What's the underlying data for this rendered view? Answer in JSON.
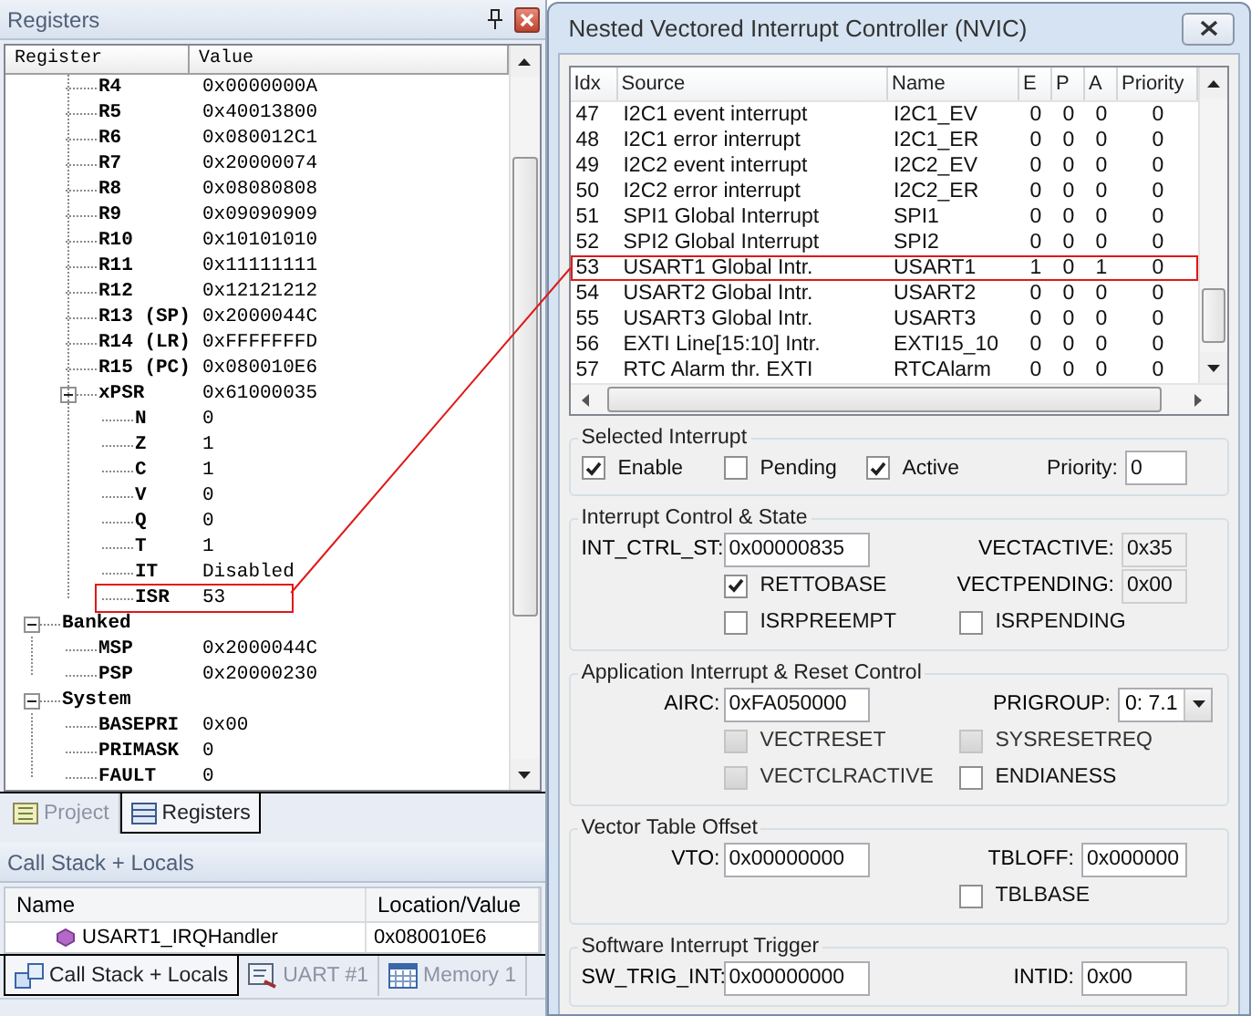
{
  "registers": {
    "title": "Registers",
    "columns": [
      "Register",
      "Value"
    ],
    "tree": [
      {
        "children": [
          {
            "name": "R4",
            "value": "0x0000000A"
          },
          {
            "name": "R5",
            "value": "0x40013800"
          },
          {
            "name": "R6",
            "value": "0x080012C1"
          },
          {
            "name": "R7",
            "value": "0x20000074"
          },
          {
            "name": "R8",
            "value": "0x08080808"
          },
          {
            "name": "R9",
            "value": "0x09090909"
          },
          {
            "name": "R10",
            "value": "0x10101010"
          },
          {
            "name": "R11",
            "value": "0x11111111"
          },
          {
            "name": "R12",
            "value": "0x12121212"
          },
          {
            "name": "R13 (SP)",
            "value": "0x2000044C"
          },
          {
            "name": "R14 (LR)",
            "value": "0xFFFFFFFD"
          },
          {
            "name": "R15 (PC)",
            "value": "0x080010E6"
          },
          {
            "name": "xPSR",
            "value": "0x61000035",
            "expanded": true,
            "children": [
              {
                "name": "N",
                "value": "0"
              },
              {
                "name": "Z",
                "value": "1"
              },
              {
                "name": "C",
                "value": "1"
              },
              {
                "name": "V",
                "value": "0"
              },
              {
                "name": "Q",
                "value": "0"
              },
              {
                "name": "T",
                "value": "1"
              },
              {
                "name": "IT",
                "value": "Disabled"
              },
              {
                "name": "ISR",
                "value": "53",
                "highlighted": true
              }
            ]
          }
        ]
      },
      {
        "name": "Banked",
        "expanded": true,
        "children": [
          {
            "name": "MSP",
            "value": "0x2000044C"
          },
          {
            "name": "PSP",
            "value": "0x20000230"
          }
        ]
      },
      {
        "name": "System",
        "expanded": true,
        "children": [
          {
            "name": "BASEPRI",
            "value": "0x00"
          },
          {
            "name": "PRIMASK",
            "value": "0"
          },
          {
            "name": "FAULT",
            "value": "0"
          }
        ]
      }
    ]
  },
  "left_tabs": [
    {
      "label": "Project",
      "selected": false
    },
    {
      "label": "Registers",
      "selected": true
    }
  ],
  "call_stack": {
    "title": "Call Stack + Locals",
    "columns": [
      "Name",
      "Location/Value"
    ],
    "rows": [
      {
        "name": "USART1_IRQHandler",
        "value": "0x080010E6"
      }
    ]
  },
  "bottom_tabs": [
    {
      "label": "Call Stack + Locals",
      "selected": true
    },
    {
      "label": "UART #1",
      "selected": false
    },
    {
      "label": "Memory 1",
      "selected": false
    }
  ],
  "nvic": {
    "title": "Nested Vectored Interrupt Controller (NVIC)",
    "columns": [
      "Idx",
      "Source",
      "Name",
      "E",
      "P",
      "A",
      "Priority"
    ],
    "rows": [
      {
        "idx": "47",
        "source": "I2C1 event interrupt",
        "name": "I2C1_EV",
        "e": "0",
        "p": "0",
        "a": "0",
        "priority": "0",
        "highlighted": false
      },
      {
        "idx": "48",
        "source": "I2C1 error interrupt",
        "name": "I2C1_ER",
        "e": "0",
        "p": "0",
        "a": "0",
        "priority": "0",
        "highlighted": false
      },
      {
        "idx": "49",
        "source": "I2C2 event interrupt",
        "name": "I2C2_EV",
        "e": "0",
        "p": "0",
        "a": "0",
        "priority": "0",
        "highlighted": false
      },
      {
        "idx": "50",
        "source": "I2C2 error interrupt",
        "name": "I2C2_ER",
        "e": "0",
        "p": "0",
        "a": "0",
        "priority": "0",
        "highlighted": false
      },
      {
        "idx": "51",
        "source": "SPI1 Global Interrupt",
        "name": "SPI1",
        "e": "0",
        "p": "0",
        "a": "0",
        "priority": "0",
        "highlighted": false
      },
      {
        "idx": "52",
        "source": "SPI2 Global Interrupt",
        "name": "SPI2",
        "e": "0",
        "p": "0",
        "a": "0",
        "priority": "0",
        "highlighted": false
      },
      {
        "idx": "53",
        "source": "USART1 Global Intr.",
        "name": "USART1",
        "e": "1",
        "p": "0",
        "a": "1",
        "priority": "0",
        "highlighted": true
      },
      {
        "idx": "54",
        "source": "USART2 Global Intr.",
        "name": "USART2",
        "e": "0",
        "p": "0",
        "a": "0",
        "priority": "0",
        "highlighted": false
      },
      {
        "idx": "55",
        "source": "USART3 Global Intr.",
        "name": "USART3",
        "e": "0",
        "p": "0",
        "a": "0",
        "priority": "0",
        "highlighted": false
      },
      {
        "idx": "56",
        "source": "EXTI Line[15:10] Intr.",
        "name": "EXTI15_10",
        "e": "0",
        "p": "0",
        "a": "0",
        "priority": "0",
        "highlighted": false
      },
      {
        "idx": "57",
        "source": "RTC Alarm thr. EXTI",
        "name": "RTCAlarm",
        "e": "0",
        "p": "0",
        "a": "0",
        "priority": "0",
        "highlighted": false
      }
    ],
    "selected_interrupt": {
      "title": "Selected Interrupt",
      "items": [
        {
          "kind": "checkbox",
          "label": "Enable",
          "checked": true
        },
        {
          "kind": "checkbox",
          "label": "Pending",
          "checked": false
        },
        {
          "kind": "checkbox",
          "label": "Active",
          "checked": true
        },
        {
          "kind": "field",
          "label": "Priority:",
          "value": "0"
        }
      ]
    },
    "groups": [
      {
        "title": "Interrupt Control & State",
        "rows": [
          {
            "left": {
              "kind": "field",
              "label": "INT_CTRL_ST:",
              "value": "0x00000835"
            },
            "right": {
              "kind": "readout",
              "label": "VECTACTIVE:",
              "value": "0x35"
            }
          },
          {
            "left": {
              "kind": "checkbox",
              "label": "RETTOBASE",
              "checked": true,
              "disabled": false
            },
            "right": {
              "kind": "readout",
              "label": "VECTPENDING:",
              "value": "0x00"
            }
          },
          {
            "left": {
              "kind": "checkbox",
              "label": "ISRPREEMPT",
              "checked": false,
              "disabled": false
            },
            "right": {
              "kind": "checkbox",
              "label": "ISRPENDING",
              "checked": false,
              "disabled": false
            }
          }
        ]
      },
      {
        "title": "Application Interrupt & Reset Control",
        "rows": [
          {
            "left": {
              "kind": "field",
              "label": "AIRC:",
              "value": "0xFA050000"
            },
            "right": {
              "kind": "dropdown",
              "label": "PRIGROUP:",
              "value": "0: 7.1"
            }
          },
          {
            "left": {
              "kind": "checkbox",
              "label": "VECTRESET",
              "checked": false,
              "disabled": true
            },
            "right": {
              "kind": "checkbox",
              "label": "SYSRESETREQ",
              "checked": false,
              "disabled": true
            }
          },
          {
            "left": {
              "kind": "checkbox",
              "label": "VECTCLRACTIVE",
              "checked": false,
              "disabled": true
            },
            "right": {
              "kind": "checkbox",
              "label": "ENDIANESS",
              "checked": false,
              "disabled": false
            }
          }
        ]
      },
      {
        "title": "Vector Table Offset",
        "rows": [
          {
            "left": {
              "kind": "field",
              "label": "VTO:",
              "value": "0x00000000"
            },
            "right": {
              "kind": "field",
              "label": "TBLOFF:",
              "value": "0x000000"
            }
          },
          {
            "right": {
              "kind": "checkbox",
              "label": "TBLBASE",
              "checked": false,
              "disabled": false
            }
          }
        ]
      },
      {
        "title": "Software Interrupt Trigger",
        "rows": [
          {
            "left": {
              "kind": "field",
              "label": "SW_TRIG_INT:",
              "value": "0x00000000"
            },
            "right": {
              "kind": "field",
              "label": "INTID:",
              "value": "0x00"
            }
          }
        ]
      }
    ]
  }
}
